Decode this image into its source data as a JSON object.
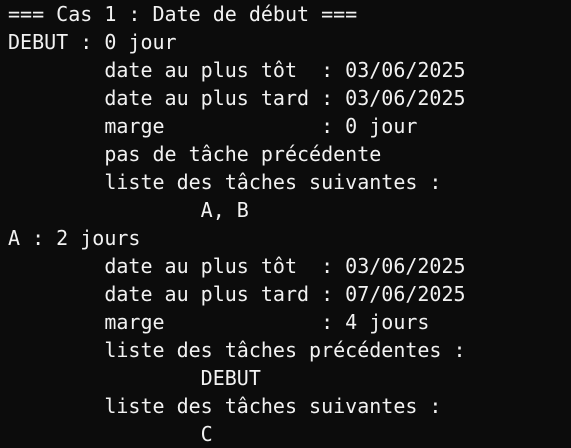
{
  "terminal": {
    "lines": [
      "=== Cas 1 : Date de début ===",
      "DEBUT : 0 jour",
      "        date au plus tôt  : 03/06/2025",
      "        date au plus tard : 03/06/2025",
      "        marge             : 0 jour",
      "        pas de tâche précédente",
      "        liste des tâches suivantes :",
      "                A, B",
      "A : 2 jours",
      "        date au plus tôt  : 03/06/2025",
      "        date au plus tard : 07/06/2025",
      "        marge             : 4 jours",
      "        liste des tâches précédentes :",
      "                DEBUT",
      "        liste des tâches suivantes :",
      "                C"
    ]
  }
}
